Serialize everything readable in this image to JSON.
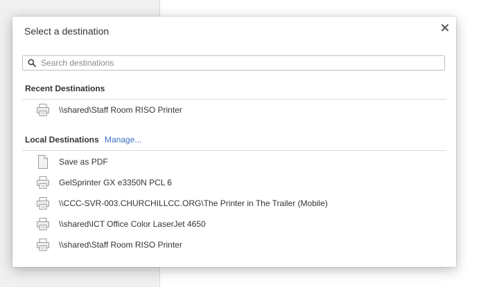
{
  "dialog": {
    "title": "Select a destination",
    "close_glyph": "×"
  },
  "search": {
    "placeholder": "Search destinations",
    "value": ""
  },
  "recent": {
    "header": "Recent Destinations",
    "items": [
      {
        "label": "\\\\shared\\Staff Room RISO Printer",
        "icon": "printer-icon"
      }
    ]
  },
  "local": {
    "header": "Local Destinations",
    "manage_label": "Manage...",
    "items": [
      {
        "label": "Save as PDF",
        "icon": "pdf-document-icon"
      },
      {
        "label": "GelSprinter GX e3350N PCL 6",
        "icon": "printer-icon"
      },
      {
        "label": "\\\\CCC-SVR-003.CHURCHILLCC.ORG\\The Printer in The Trailer (Mobile)",
        "icon": "printer-icon"
      },
      {
        "label": "\\\\shared\\ICT Office Color LaserJet 4650",
        "icon": "printer-icon"
      },
      {
        "label": "\\\\shared\\Staff Room RISO Printer",
        "icon": "printer-icon"
      }
    ]
  },
  "colors": {
    "link": "#3b6ec4",
    "text": "#333333",
    "divider": "#dcdcdc"
  }
}
